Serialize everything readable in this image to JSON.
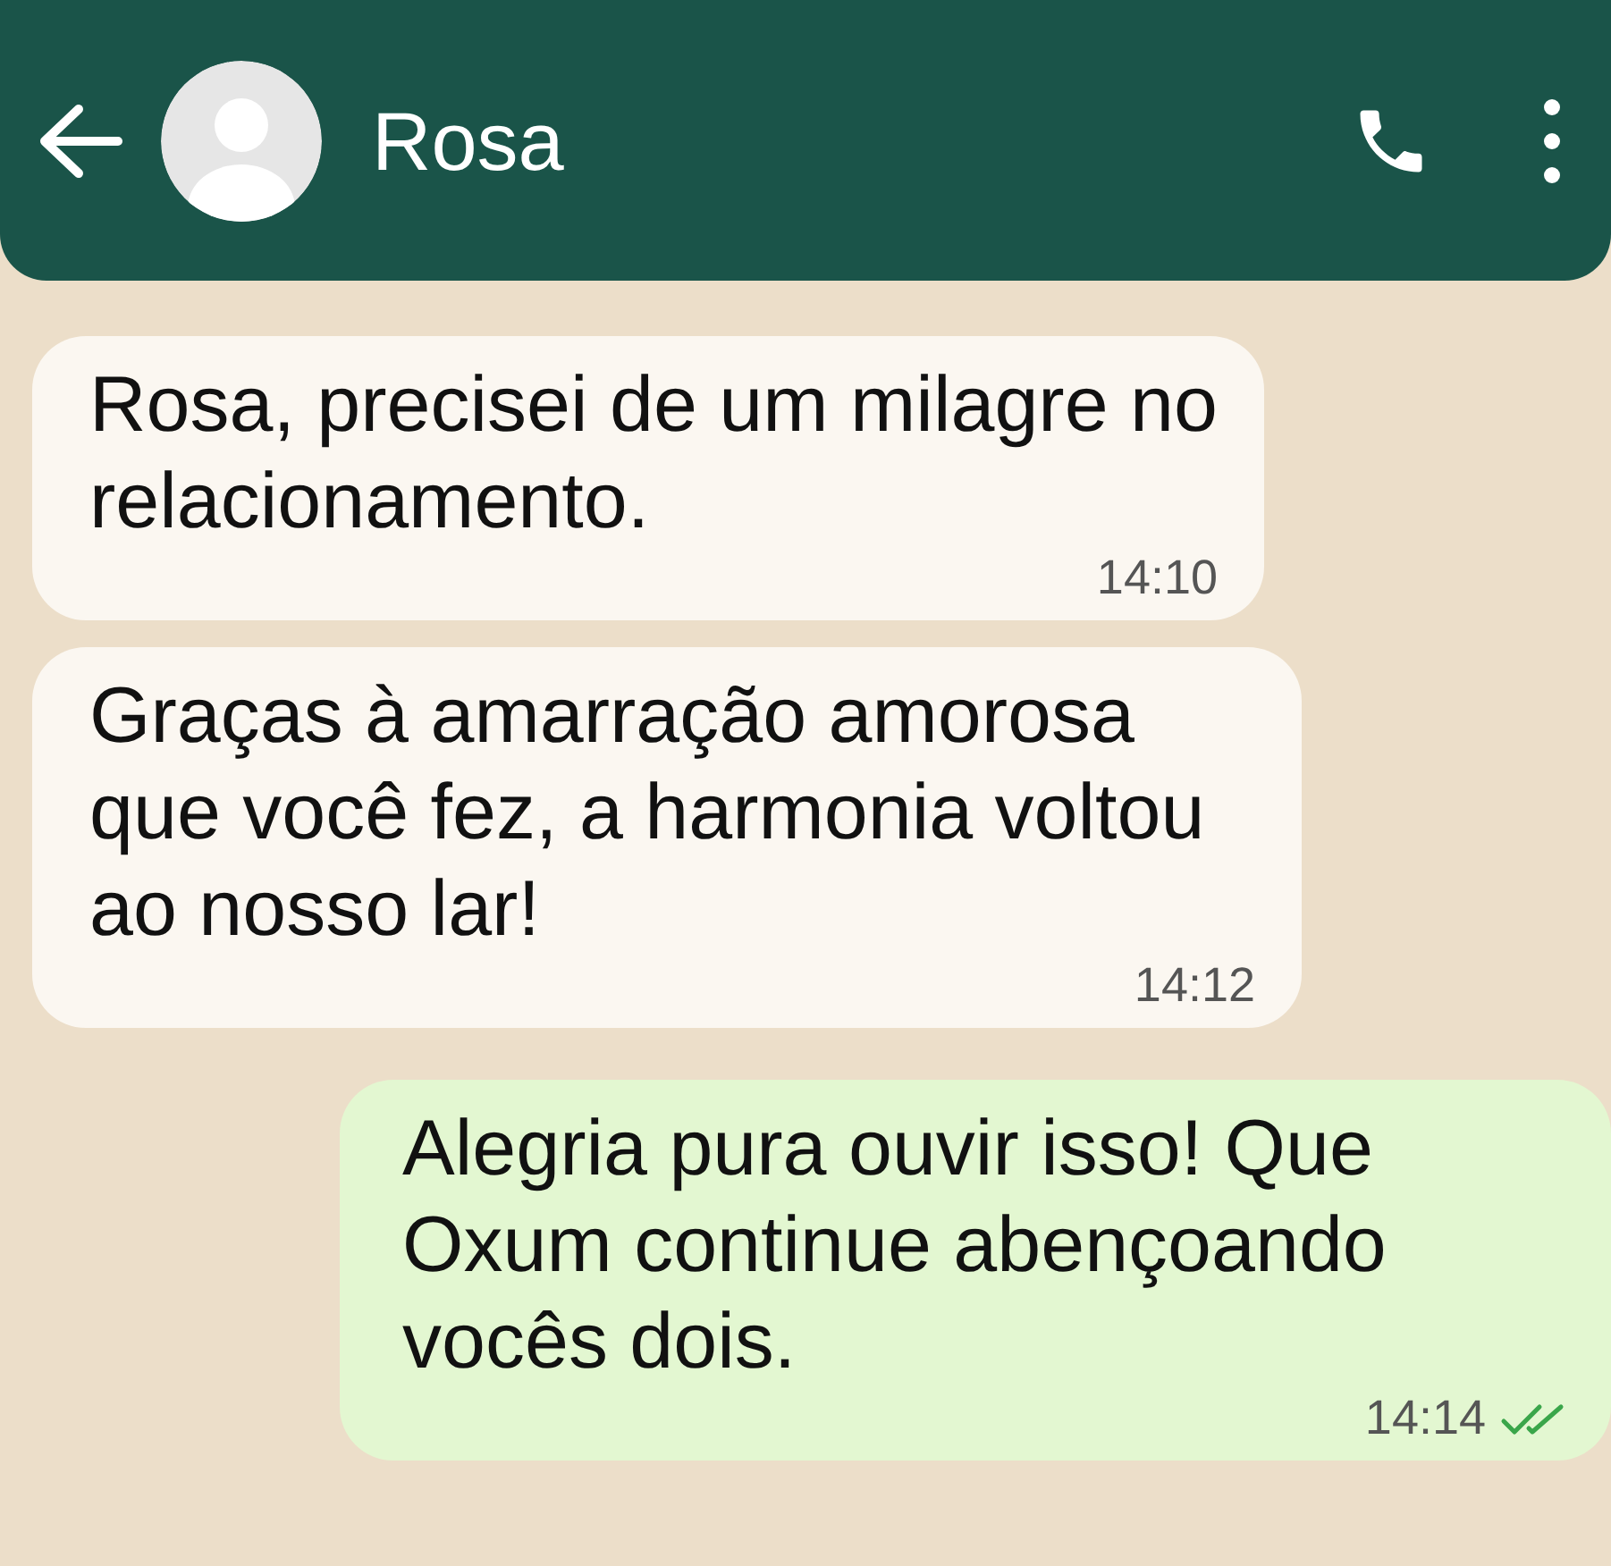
{
  "header": {
    "contact_name": "Rosa"
  },
  "messages": [
    {
      "kind": "incoming",
      "text": "Rosa, precisei de um milagre no relacionamento.",
      "time": "14:10"
    },
    {
      "kind": "incoming",
      "text": "Graças à amarração amorosa que você fez, a harmonia voltou ao nosso lar!",
      "time": "14:12"
    },
    {
      "kind": "outgoing",
      "text": "Alegria pura ouvir isso! Que Oxum continue abençoando vocês dois.",
      "time": "14:14",
      "read": true
    }
  ]
}
